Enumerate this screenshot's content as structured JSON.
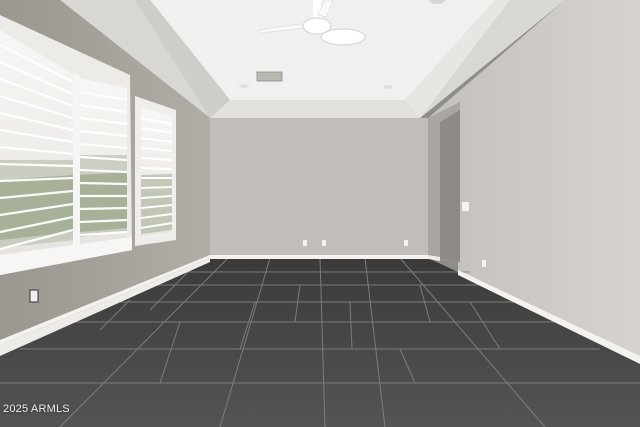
{
  "photo": {
    "subject": "empty-room-with-tile-floor",
    "watermark": "2025 ARMLS"
  },
  "colors": {
    "ceiling": "#f1f0ee",
    "wall_back": "#c1bdb8",
    "wall_left": "#a9a59f",
    "wall_right": "#cfcbc7",
    "floor": "#4c4b4b",
    "grout": "#9a9893",
    "baseboard": "#f4f2ef"
  }
}
